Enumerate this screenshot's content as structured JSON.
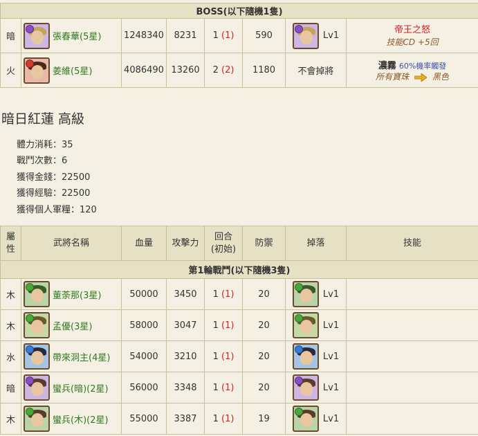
{
  "boss": {
    "caption": "BOSS(以下隨機1隻)",
    "rows": [
      {
        "attr": "暗",
        "name": "張春華(5星)",
        "hp": "1248340",
        "atk": "8231",
        "round": "1",
        "round_init": "(1)",
        "def": "590",
        "drop": "Lv1",
        "skill_title": "帝王之怒",
        "skill_sub": "技能CD +5回",
        "orb": "#8a4fc4",
        "hair": "#c8a35a"
      },
      {
        "attr": "火",
        "name": "姜維(5星)",
        "hp": "4086490",
        "atk": "13260",
        "round": "2",
        "round_init": "(2)",
        "def": "1180",
        "drop": "不會掉將",
        "skill_bold": "濃霧",
        "skill_blue": "60%機率觸發",
        "skill_from": "所有寶珠",
        "skill_to": "黑色",
        "orb": "#d43a2a",
        "hair": "#4a2a1a"
      }
    ]
  },
  "stage": {
    "title": "暗日紅蓮 高級",
    "stats": [
      "體力消耗：35",
      "戰鬥次數：6",
      "獲得金錢：22500",
      "獲得經驗：22500",
      "獲得個人軍糧：120"
    ]
  },
  "table": {
    "headers": {
      "attr": "屬\n性",
      "name": "武將名稱",
      "hp": "血量",
      "atk": "攻擊力",
      "round": "回合\n(初始)",
      "def": "防禦",
      "drop": "掉落",
      "skill": "技能"
    },
    "wave_caption": "第1輪戰鬥(以下隨機3隻)",
    "rows": [
      {
        "attr": "木",
        "name": "董荼那(3星)",
        "hp": "50000",
        "atk": "3450",
        "round": "1",
        "round_init": "(1)",
        "def": "20",
        "drop": "Lv1",
        "orb": "#4aa83a",
        "hair": "#3b5a2a"
      },
      {
        "attr": "木",
        "name": "孟優(3星)",
        "hp": "58000",
        "atk": "3047",
        "round": "1",
        "round_init": "(1)",
        "def": "20",
        "drop": "Lv1",
        "orb": "#4aa83a",
        "hair": "#6a5a2a"
      },
      {
        "attr": "水",
        "name": "帶來洞主(4星)",
        "hp": "54000",
        "atk": "3210",
        "round": "1",
        "round_init": "(1)",
        "def": "20",
        "drop": "Lv1",
        "orb": "#3a7ad4",
        "hair": "#2a2a3a"
      },
      {
        "attr": "暗",
        "name": "蠻兵(暗)(2星)",
        "hp": "56000",
        "atk": "3348",
        "round": "1",
        "round_init": "(1)",
        "def": "20",
        "drop": "Lv1",
        "orb": "#8a4fc4",
        "hair": "#5a3a2a"
      },
      {
        "attr": "木",
        "name": "蠻兵(木)(2星)",
        "hp": "55000",
        "atk": "3387",
        "round": "1",
        "round_init": "(1)",
        "def": "19",
        "drop": "Lv1",
        "orb": "#4aa83a",
        "hair": "#5a3a2a"
      }
    ]
  },
  "colors": {
    "background": "#f5f0e4",
    "header_bg": "#e6e1c5",
    "border": "#c9bf98",
    "name_green": "#2f7a1f",
    "accent_red": "#d42020"
  }
}
